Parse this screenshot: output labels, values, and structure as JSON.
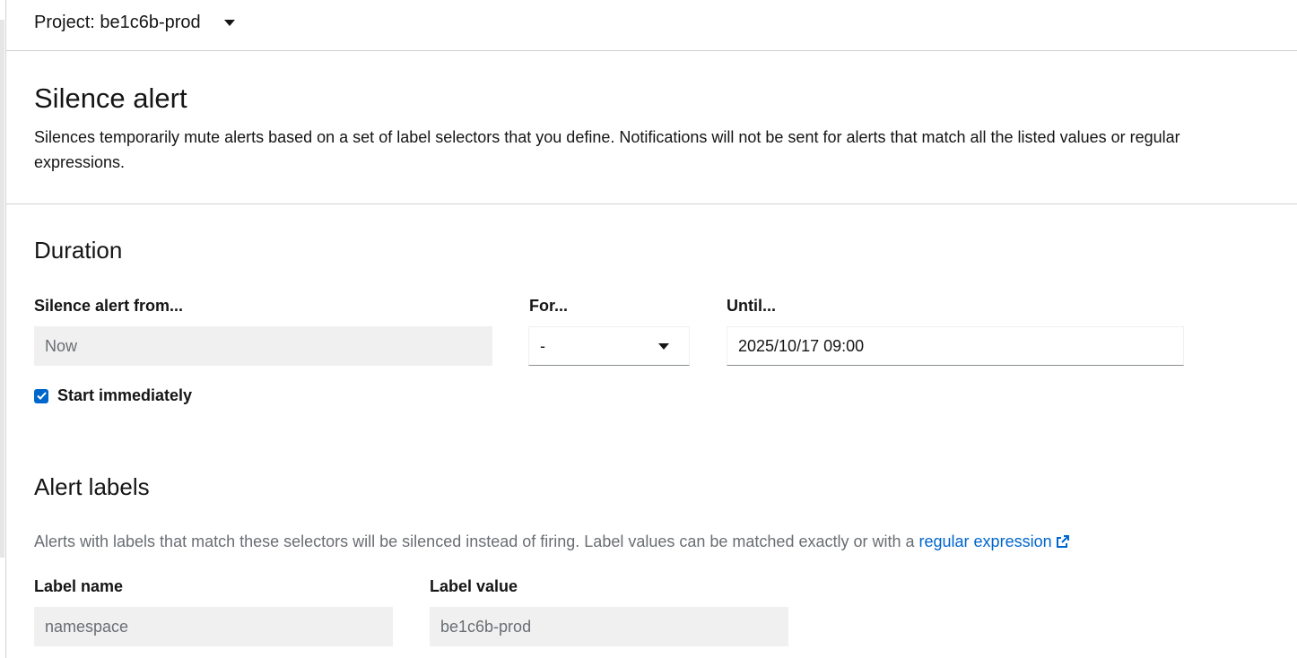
{
  "project": {
    "label": "Project: be1c6b-prod"
  },
  "header": {
    "title": "Silence alert",
    "description": "Silences temporarily mute alerts based on a set of label selectors that you define. Notifications will not be sent for alerts that match all the listed values or regular expressions."
  },
  "duration": {
    "title": "Duration",
    "from_label": "Silence alert from...",
    "from_value": "Now",
    "for_label": "For...",
    "for_value": "-",
    "until_label": "Until...",
    "until_value": "2025/10/17 09:00",
    "start_immediately_label": "Start immediately",
    "start_immediately_checked": true
  },
  "alert_labels": {
    "title": "Alert labels",
    "help_text": "Alerts with labels that match these selectors will be silenced instead of firing. Label values can be matched exactly or with a ",
    "help_link": "regular expression",
    "label_name_header": "Label name",
    "label_value_header": "Label value",
    "label_name_value": "namespace",
    "label_value_value": "be1c6b-prod"
  },
  "colors": {
    "link": "#0066cc",
    "checkbox": "#0066cc",
    "disabled_bg": "#f0f0f0"
  }
}
